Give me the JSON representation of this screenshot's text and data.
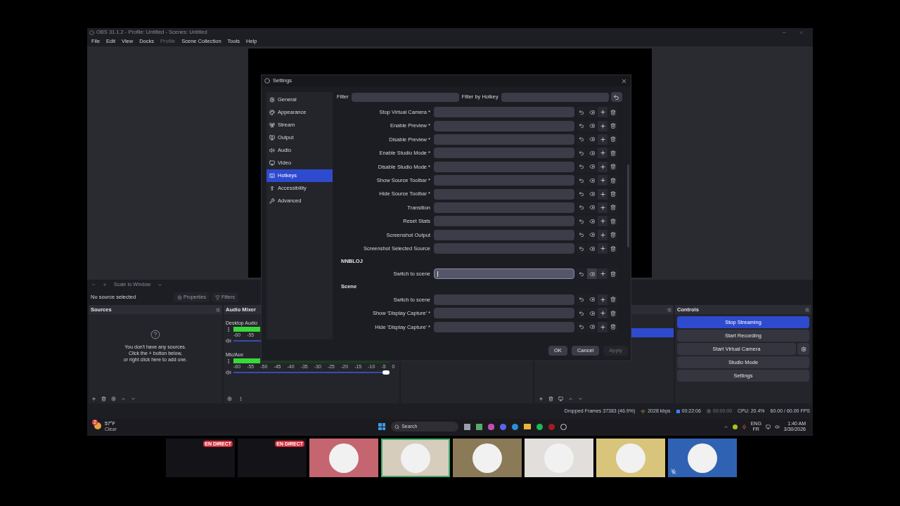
{
  "window": {
    "title": "OBS 31.1.2 - Profile: Untitled - Scenes: Untitled"
  },
  "menu": [
    {
      "label": "File",
      "disabled": false
    },
    {
      "label": "Edit",
      "disabled": false
    },
    {
      "label": "View",
      "disabled": false
    },
    {
      "label": "Docks",
      "disabled": false
    },
    {
      "label": "Profile",
      "disabled": true
    },
    {
      "label": "Scene Collection",
      "disabled": false
    },
    {
      "label": "Tools",
      "disabled": false
    },
    {
      "label": "Help",
      "disabled": false
    }
  ],
  "preview_toolbar": {
    "scale_mode": "Scale to Window"
  },
  "source_bar": {
    "status": "No source selected",
    "buttons": [
      "Properties",
      "Filters"
    ]
  },
  "sources": {
    "title": "Sources",
    "empty_message": [
      "You don't have any sources.",
      "Click the + button below,",
      "or right click here to add one."
    ]
  },
  "audio_mixer": {
    "title": "Audio Mixer",
    "channels": [
      {
        "name": "Desktop Audio",
        "level": 0.17,
        "ticks": [
          "-60",
          "-55"
        ]
      },
      {
        "name": "Mic/Aux",
        "level": 0.17,
        "volume": {
          "level": 1
        },
        "ticks": [
          "-60",
          "-55",
          "-50",
          "-45",
          "-40",
          "-35",
          "-30",
          "-25",
          "-20",
          "-15",
          "-10",
          "-5",
          "0"
        ]
      }
    ]
  },
  "scenes": {
    "items": [
      {
        "selected": true
      }
    ]
  },
  "controls": {
    "title": "Controls",
    "buttons": [
      {
        "label": "Stop Streaming",
        "active": true,
        "kind": "plain"
      },
      {
        "label": "Start Recording",
        "active": false,
        "kind": "plain"
      },
      {
        "label": "Start Virtual Camera",
        "active": false,
        "kind": "with_settings"
      },
      {
        "label": "Studio Mode",
        "active": false,
        "kind": "plain"
      },
      {
        "label": "Settings",
        "active": false,
        "kind": "plain"
      }
    ]
  },
  "status_bar": [
    {
      "kind": "text",
      "text": "Dropped Frames 37383 (46.9%)"
    },
    {
      "kind": "bitrate",
      "text": "2028 kbps"
    },
    {
      "kind": "stream_time",
      "text": "00:22:06"
    },
    {
      "kind": "record_time",
      "text": "00:00:00"
    },
    {
      "kind": "text",
      "text": "CPU: 20.4%"
    },
    {
      "kind": "text",
      "text": "60.00 / 60.00 FPS"
    }
  ],
  "settings": {
    "title": "Settings",
    "sidebar": [
      {
        "label": "General",
        "selected": false
      },
      {
        "label": "Appearance",
        "selected": false
      },
      {
        "label": "Stream",
        "selected": false
      },
      {
        "label": "Output",
        "selected": false
      },
      {
        "label": "Audio",
        "selected": false
      },
      {
        "label": "Video",
        "selected": false
      },
      {
        "label": "Hotkeys",
        "selected": true
      },
      {
        "label": "Accessibility",
        "selected": false
      },
      {
        "label": "Advanced",
        "selected": false
      }
    ],
    "filter_label": "Filter",
    "filter_by_hotkey_label": "Filter by Hotkey",
    "hotkeys": [
      {
        "kind": "row",
        "label": "Stop Virtual Camera *",
        "focused": false
      },
      {
        "kind": "row",
        "label": "Enable Preview *",
        "focused": false
      },
      {
        "kind": "row",
        "label": "Disable Preview *",
        "focused": false
      },
      {
        "kind": "row",
        "label": "Enable Studio Mode *",
        "focused": false
      },
      {
        "kind": "row",
        "label": "Disable Studio Mode *",
        "focused": false
      },
      {
        "kind": "row",
        "label": "Show Source Toolbar *",
        "focused": false
      },
      {
        "kind": "row",
        "label": "Hide Source Toolbar *",
        "focused": false
      },
      {
        "kind": "row",
        "label": "Transition",
        "focused": false
      },
      {
        "kind": "row",
        "label": "Reset Stats",
        "focused": false
      },
      {
        "kind": "row",
        "label": "Screenshot Output",
        "focused": false
      },
      {
        "kind": "row",
        "label": "Screenshot Selected Source",
        "focused": false
      },
      {
        "kind": "group",
        "label": "NNBLOJ"
      },
      {
        "kind": "row",
        "label": "Switch to scene",
        "focused": true
      },
      {
        "kind": "group",
        "label": "Scene"
      },
      {
        "kind": "row",
        "label": "Switch to scene",
        "focused": false
      },
      {
        "kind": "row",
        "label": "Show 'Display Capture' *",
        "focused": false
      },
      {
        "kind": "row",
        "label": "Hide 'Display Capture' *",
        "focused": false
      }
    ],
    "buttons": [
      {
        "label": "OK",
        "disabled": false
      },
      {
        "label": "Cancel",
        "disabled": false
      },
      {
        "label": "Apply",
        "disabled": true
      }
    ]
  },
  "taskbar": {
    "weather": {
      "badge": "2",
      "temp": "57°F",
      "condition": "Clear"
    },
    "search": "Search",
    "language": [
      "ENG",
      "FR"
    ],
    "time": "1:40 AM",
    "date": "3/30/2026"
  },
  "participants": [
    {
      "kind": "screen",
      "badge": "EN DIRECT",
      "selected": false
    },
    {
      "kind": "screen",
      "badge": "EN DIRECT",
      "selected": false
    },
    {
      "kind": "avatar",
      "color": "#c4656f",
      "selected": false,
      "muted": false
    },
    {
      "kind": "avatar",
      "color": "#d6cdbd",
      "selected": true,
      "muted": false
    },
    {
      "kind": "avatar",
      "color": "#8a7a57",
      "selected": false,
      "muted": false
    },
    {
      "kind": "avatar",
      "color": "#e1dedb",
      "selected": false,
      "muted": false
    },
    {
      "kind": "avatar",
      "color": "#d8c47a",
      "selected": false,
      "muted": false
    },
    {
      "kind": "avatar",
      "color": "#2f62b2",
      "selected": false,
      "muted": true
    }
  ]
}
